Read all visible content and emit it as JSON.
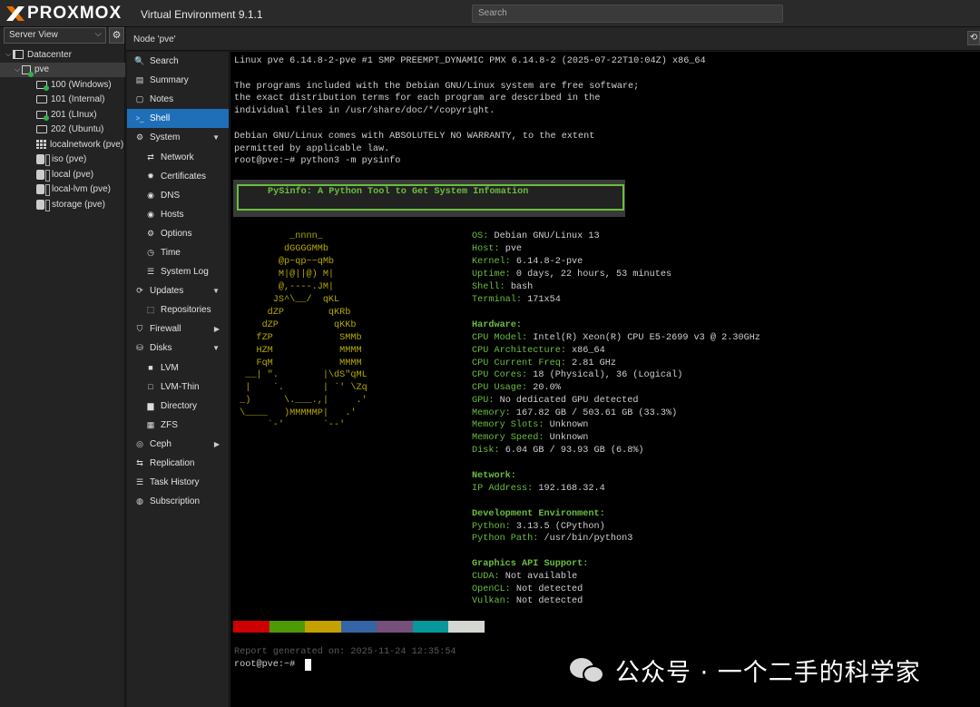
{
  "header": {
    "brand": "PROXMOX",
    "product": "Virtual Environment 9.1.1",
    "search_placeholder": "Search"
  },
  "tree": {
    "view_selector": "Server View",
    "items": [
      {
        "label": "Datacenter",
        "icon": "datacenter-icon"
      },
      {
        "label": "pve",
        "icon": "node-icon",
        "selected": true
      },
      {
        "label": "100 (Windows)",
        "icon": "vm-running-icon"
      },
      {
        "label": "101 (Internal)",
        "icon": "vm-icon"
      },
      {
        "label": "201 (LInux)",
        "icon": "vm-running-icon"
      },
      {
        "label": "202 (Ubuntu)",
        "icon": "vm-icon"
      },
      {
        "label": "localnetwork (pve)",
        "icon": "network-icon"
      },
      {
        "label": "iso (pve)",
        "icon": "storage-icon"
      },
      {
        "label": "local (pve)",
        "icon": "storage-icon"
      },
      {
        "label": "local-lvm (pve)",
        "icon": "storage-icon"
      },
      {
        "label": "storage (pve)",
        "icon": "storage-icon"
      }
    ]
  },
  "node_header": {
    "title": "Node 'pve'"
  },
  "menu": {
    "items": [
      {
        "label": "Search",
        "icon": "search-icon",
        "glyph": "🔍"
      },
      {
        "label": "Summary",
        "icon": "summary-icon",
        "glyph": "▤"
      },
      {
        "label": "Notes",
        "icon": "notes-icon",
        "glyph": "▢"
      },
      {
        "label": "Shell",
        "icon": "terminal-icon",
        "glyph": ">_"
      },
      {
        "label": "System",
        "icon": "gear-icon",
        "glyph": "⚙"
      },
      {
        "label": "Network",
        "icon": "network-icon",
        "glyph": "⇄"
      },
      {
        "label": "Certificates",
        "icon": "certificate-icon",
        "glyph": "✹"
      },
      {
        "label": "DNS",
        "icon": "globe-icon",
        "glyph": "◉"
      },
      {
        "label": "Hosts",
        "icon": "globe-icon",
        "glyph": "◉"
      },
      {
        "label": "Options",
        "icon": "gear-icon",
        "glyph": "⚙"
      },
      {
        "label": "Time",
        "icon": "clock-icon",
        "glyph": "◷"
      },
      {
        "label": "System Log",
        "icon": "list-icon",
        "glyph": "☰"
      },
      {
        "label": "Updates",
        "icon": "refresh-icon",
        "glyph": "⟳"
      },
      {
        "label": "Repositories",
        "icon": "package-icon",
        "glyph": "⬚"
      },
      {
        "label": "Firewall",
        "icon": "shield-icon",
        "glyph": "⛉"
      },
      {
        "label": "Disks",
        "icon": "disk-icon",
        "glyph": "⛁"
      },
      {
        "label": "LVM",
        "icon": "square-icon",
        "glyph": "■"
      },
      {
        "label": "LVM-Thin",
        "icon": "square-outline-icon",
        "glyph": "□"
      },
      {
        "label": "Directory",
        "icon": "folder-icon",
        "glyph": "▆"
      },
      {
        "label": "ZFS",
        "icon": "grid-icon",
        "glyph": "▦"
      },
      {
        "label": "Ceph",
        "icon": "ceph-icon",
        "glyph": "◎"
      },
      {
        "label": "Replication",
        "icon": "replication-icon",
        "glyph": "⇆"
      },
      {
        "label": "Task History",
        "icon": "list-icon",
        "glyph": "☰"
      },
      {
        "label": "Subscription",
        "icon": "support-icon",
        "glyph": "◍"
      }
    ]
  },
  "terminal": {
    "lines": [
      "Linux pve 6.14.8-2-pve #1 SMP PREEMPT_DYNAMIC PMX 6.14.8-2 (2025-07-22T10:04Z) x86_64",
      "",
      "The programs included with the Debian GNU/Linux system are free software;",
      "the exact distribution terms for each program are described in the",
      "individual files in /usr/share/doc/*/copyright.",
      "",
      "Debian GNU/Linux comes with ABSOLUTELY NO WARRANTY, to the extent",
      "permitted by applicable law.",
      "root@pve:~# python3 -m pysinfo"
    ],
    "banner": "PySinfo: A Python Tool to Get System Infomation",
    "ascii_art": [
      "          _nnnn_",
      "         dGGGGMMb",
      "        @p~qp~~qMb",
      "        M|@||@) M|",
      "        @,----.JM|",
      "       JS^\\__/  qKL",
      "      dZP        qKRb",
      "     dZP          qKKb",
      "    fZP            SMMb",
      "    HZM            MMMM",
      "    FqM            MMMM",
      "  __| \".        |\\dS\"qML",
      "  |    `.       | `' \\Zq",
      " _)      \\.___.,|     .'",
      " \\____   )MMMMMP|   .'",
      "      `-'       `--'"
    ],
    "info": {
      "os_label": "OS:",
      "os_value": "Debian GNU/Linux 13",
      "host_label": "Host:",
      "host_value": "pve",
      "kernel_label": "Kernel:",
      "kernel_value": "6.14.8-2-pve",
      "uptime_label": "Uptime:",
      "uptime_value": "0 days, 22 hours, 53 minutes",
      "shell_label": "Shell:",
      "shell_value": "bash",
      "terminal_label": "Terminal:",
      "terminal_value": "171x54",
      "hardware_heading": "Hardware:",
      "cpu_model_label": "CPU Model:",
      "cpu_model_value": "Intel(R) Xeon(R) CPU E5-2699 v3 @ 2.30GHz",
      "cpu_arch_label": "CPU Architecture:",
      "cpu_arch_value": "x86_64",
      "cpu_freq_label": "CPU Current Freq:",
      "cpu_freq_value": "2.81 GHz",
      "cpu_cores_label": "CPU Cores:",
      "cpu_cores_value": "18 (Physical), 36 (Logical)",
      "cpu_usage_label": "CPU Usage:",
      "cpu_usage_value": "20.0%",
      "gpu_label": "GPU:",
      "gpu_value": "No dedicated GPU detected",
      "memory_label": "Memory:",
      "memory_value": "167.82 GB / 503.61 GB (33.3%)",
      "mem_slots_label": "Memory Slots:",
      "mem_slots_value": "Unknown",
      "mem_speed_label": "Memory Speed:",
      "mem_speed_value": "Unknown",
      "disk_label": "Disk:",
      "disk_value": "6.04 GB / 93.93 GB (6.8%)",
      "network_heading": "Network:",
      "ip_label": "IP Address:",
      "ip_value": "192.168.32.4",
      "dev_heading": "Development Environment:",
      "python_label": "Python:",
      "python_value": "3.13.5 (CPython)",
      "python_path_label": "Python Path:",
      "python_path_value": "/usr/bin/python3",
      "gfx_heading": "Graphics API Support:",
      "cuda_label": "CUDA:",
      "cuda_value": "Not available",
      "opencl_label": "OpenCL:",
      "opencl_value": "Not detected",
      "vulkan_label": "Vulkan:",
      "vulkan_value": "Not detected"
    },
    "palette": [
      "#cc0000",
      "#4e9a06",
      "#c4a000",
      "#3465a4",
      "#75507b",
      "#06989a",
      "#d3d7cf"
    ],
    "report": "Report generated on: 2025-11-24 12:35:54",
    "prompt": "root@pve:~#"
  },
  "watermark": {
    "text": "公众号 · 一个二手的科学家"
  }
}
